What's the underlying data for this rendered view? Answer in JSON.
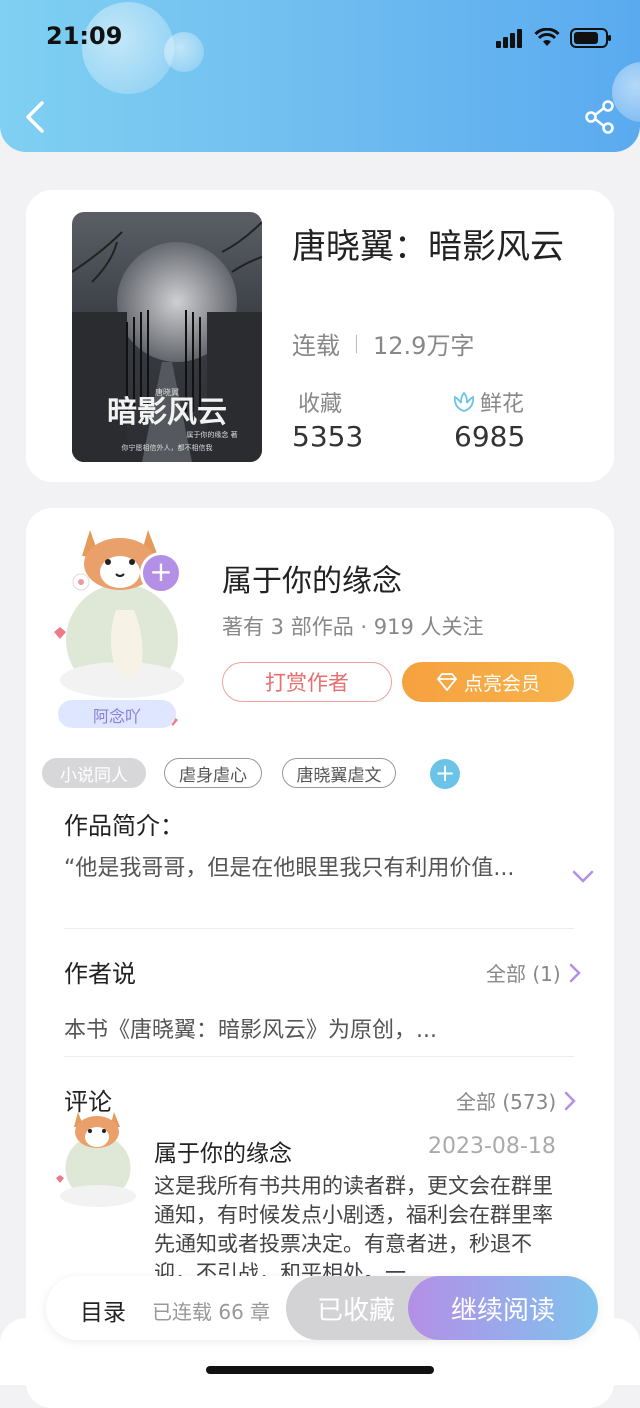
{
  "status": {
    "time": "21:09"
  },
  "book": {
    "title": "唐晓翼：暗影风云",
    "status": "连载",
    "word_count": "12.9万字",
    "collect_label": "收藏",
    "collect_count": "5353",
    "flower_label": "鲜花",
    "flower_count": "6985",
    "cover_title": "暗影风云",
    "cover_top": "唐晓翼",
    "cover_byline": "属于你的缘念 著",
    "cover_tagline": "你宁愿相信外人，都不相信我"
  },
  "author": {
    "name": "属于你的缘念",
    "sub": "著有 3 部作品 · 919 人关注",
    "nickname": "阿念吖",
    "reward_button": "打赏作者",
    "vip_button": "点亮会员"
  },
  "tags": [
    "小说同人",
    "虐身虐心",
    "唐晓翼虐文"
  ],
  "intro": {
    "title": "作品简介：",
    "text": "“他是我哥哥，但是在他眼里我只有利用价值..."
  },
  "author_says": {
    "title": "作者说",
    "all_label": "全部 (1)",
    "text": "本书《唐晓翼：暗影风云》为原创，..."
  },
  "comments": {
    "title": "评论",
    "all_label": "全部 (573)",
    "user": "属于你的缘念",
    "date": "2023-08-18",
    "text": "这是我所有书共用的读者群，更文会在群里通知，有时候发点小剧透，福利会在群里率先通知或者投票决定。有意者进，秒退不迎，不引战，和平相处。一"
  },
  "bottom": {
    "toc_label": "目录",
    "chapters": "已连载 66 章",
    "collected_button": "已收藏",
    "continue_button": "继续阅读"
  },
  "colors": {
    "header_start": "#7fd0f2",
    "header_end": "#5aaaf0",
    "accent_purple": "#b48fe6",
    "vip_orange": "#f6a13f",
    "reward_red": "#e76f6f"
  }
}
